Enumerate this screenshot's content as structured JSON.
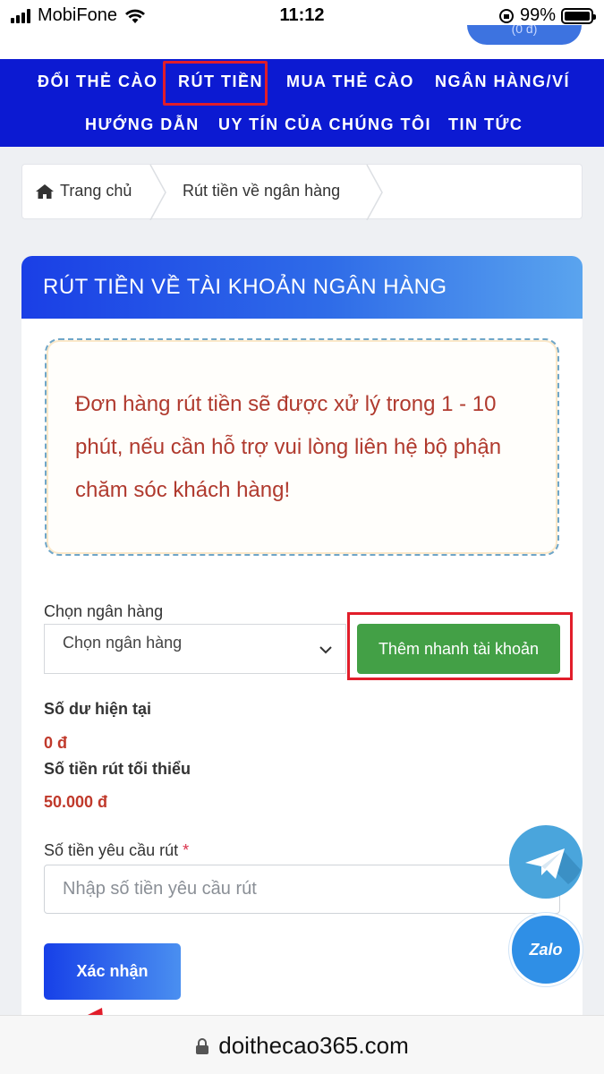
{
  "status_bar": {
    "carrier": "MobiFone",
    "time": "11:12",
    "battery": "99%",
    "battery_level": 0.99,
    "peek_text": "(0 đ)"
  },
  "nav": {
    "items": [
      "ĐỔI THẺ CÀO",
      "RÚT TIỀN",
      "MUA THẺ CÀO",
      "NGÂN HÀNG/VÍ",
      "HƯỚNG DẪN",
      "UY TÍN CỦA CHÚNG TÔI",
      "TIN TỨC"
    ],
    "active": "RÚT TIỀN"
  },
  "breadcrumb": {
    "home": "Trang chủ",
    "current": "Rút tiền về ngân hàng"
  },
  "card": {
    "title": "RÚT TIỀN VỀ TÀI KHOẢN NGÂN HÀNG",
    "notice": "Đơn hàng rút tiền sẽ được xử lý trong 1 - 10 phút, nếu cần hỗ trợ vui lòng liên hệ bộ phận chăm sóc khách hàng!"
  },
  "form": {
    "bank_label": "Chọn ngân hàng",
    "bank_selected": "Chọn ngân hàng",
    "quick_add": "Thêm nhanh tài khoản",
    "balance_label": "Số dư hiện tại",
    "balance_value": "0 đ",
    "min_label": "Số tiền rút tối thiểu",
    "min_value": "50.000 đ",
    "amount_label": "Số tiền yêu cầu rút",
    "required_mark": "*",
    "amount_placeholder": "Nhập số tiền yêu cầu rút",
    "submit": "Xác nhận"
  },
  "floating": {
    "zalo": "Zalo"
  },
  "url_bar": {
    "url": "doithecao365.com"
  },
  "colors": {
    "nav_bg": "#0c1ad2",
    "highlight": "#e11d2a",
    "quick_add_bg": "#43a046",
    "notice_text": "#b03a2e",
    "value_red": "#c0392b"
  }
}
